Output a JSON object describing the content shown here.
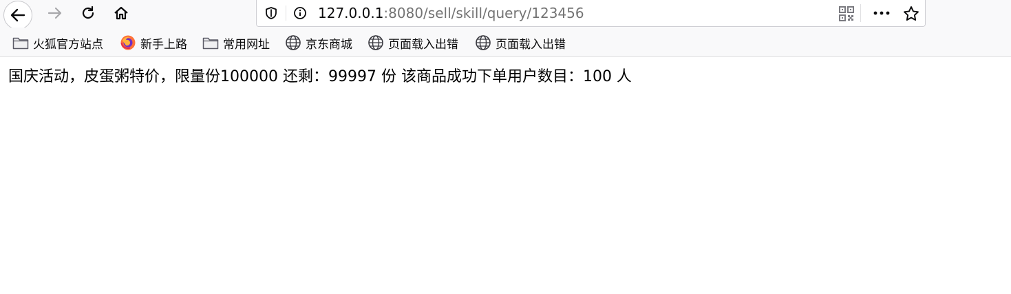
{
  "urlbar": {
    "host": "127.0.0.1",
    "rest": ":8080/sell/skill/query/123456"
  },
  "bookmarks": [
    {
      "label": "火狐官方站点",
      "icon": "folder-icon"
    },
    {
      "label": "新手上路",
      "icon": "firefox-icon"
    },
    {
      "label": "常用网址",
      "icon": "folder-icon"
    },
    {
      "label": "京东商城",
      "icon": "globe-icon"
    },
    {
      "label": "页面载入出错",
      "icon": "globe-icon"
    },
    {
      "label": "页面载入出错",
      "icon": "globe-icon"
    }
  ],
  "page": {
    "text": "国庆活动，皮蛋粥特价，限量份100000 还剩：99997 份 该商品成功下单用户数目：100 人"
  }
}
